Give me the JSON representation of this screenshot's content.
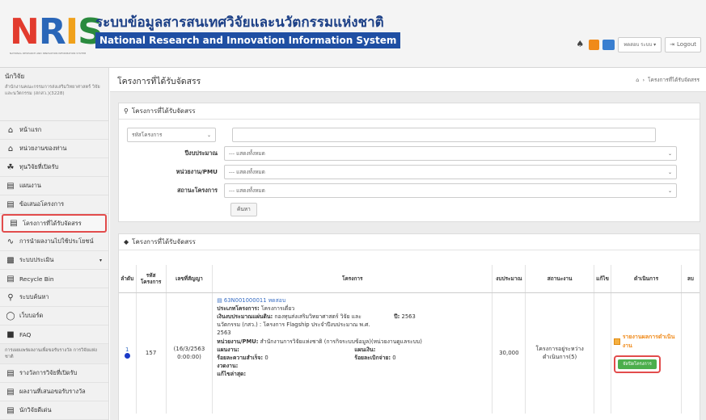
{
  "header": {
    "logo_text": "NRIS",
    "logo_subtitle": "NATIONAL RESEARCH AND INNOVATION INFORMATION SYSTEM",
    "title_th": "ระบบข้อมูลสารสนเทศวิจัยและนวัตกรรมแห่งชาติ",
    "title_en": "National Research and Innovation Information System",
    "user_label": "ทดสอบ ระบบ ▾",
    "logout_label": "Logout"
  },
  "sidebar": {
    "user_name": "นักวิจัย",
    "user_org": "สำนักงานคณะกรรมการส่งเสริมวิทยาศาสตร์ วิจัยและนวัตกรรม (สกสว.)(3228)",
    "items": [
      {
        "label": "หน้าแรก",
        "icon": "home-icon"
      },
      {
        "label": "หน่วยงานของท่าน",
        "icon": "home-icon"
      },
      {
        "label": "ทุนวิจัยที่เปิดรับ",
        "icon": "funding-icon"
      },
      {
        "label": "แผนงาน",
        "icon": "file-icon"
      },
      {
        "label": "ข้อเสนอโครงการ",
        "icon": "file-icon"
      },
      {
        "label": "โครงการที่ได้รับจัดสรร",
        "icon": "file-icon",
        "active": true
      },
      {
        "label": "การนำผลงานไปใช้ประโยชน์",
        "icon": "chart-line-icon"
      },
      {
        "label": "ระบบประเมิน",
        "icon": "bar-chart-icon",
        "caret": true
      },
      {
        "label": "Recycle Bin",
        "icon": "file-icon"
      },
      {
        "label": "ระบบค้นหา",
        "icon": "search-icon"
      },
      {
        "label": "เว็บบอร์ด",
        "icon": "globe-icon"
      },
      {
        "label": "FAQ",
        "icon": "faq-icon"
      }
    ],
    "section_label": "การเผยแพร่ผลงานเพื่อขอรับรางวัล การวิจัยแห่งชาติ",
    "items2": [
      {
        "label": "รางวัลการวิจัยที่เปิดรับ",
        "icon": "list-icon"
      },
      {
        "label": "ผลงานที่เสนอขอรับรางวัล",
        "icon": "list-icon"
      },
      {
        "label": "นักวิจัยดีเด่น",
        "icon": "list-icon"
      }
    ]
  },
  "page": {
    "title": "โครงการที่ได้รับจัดสรร",
    "breadcrumb": "โครงการที่ได้รับจัดสรร"
  },
  "search": {
    "panel_title": "โครงการที่ได้รับจัดสรร",
    "code_select": "รหัสโครงการ",
    "code_value": "",
    "fields": [
      {
        "label": "ปีงบประมาณ",
        "value": "--- แสดงทั้งหมด"
      },
      {
        "label": "หน่วยงาน/PMU",
        "value": "--- แสดงทั้งหมด"
      },
      {
        "label": "สถานะโครงการ",
        "value": "--- แสดงทั้งหมด"
      }
    ],
    "button_label": "ค้นหา"
  },
  "list": {
    "panel_title": "โครงการที่ได้รับจัดสรร",
    "columns": [
      "ลำดับ",
      "รหัสโครงการ",
      "เลขที่สัญญา",
      "โครงการ",
      "งบประมาณ",
      "สถานะงาน",
      "แก้ไข",
      "ดำเนินการ",
      "ลบ"
    ],
    "rows": [
      {
        "index": "1",
        "code": "157",
        "contract": "(16/3/2563 0:00:00)",
        "project_code": "63N001000011 ทดสอบ",
        "type_label": "ประเภทโครงการ:",
        "type_value": "โครงการเดี่ยว",
        "fund_label": "เงินงบประมาณแผ่นดิน:",
        "fund_value": "กองทุนส่งเสริมวิทยาศาสตร์ วิจัย และนวัตกรรม (กสว.) : โครงการ Flagship ประจำปีงบประมาณ พ.ศ. 2563",
        "year_label": "ปี:",
        "year_value": "2563",
        "agency_label": "หน่วยงาน/PMU:",
        "agency_value": "สำนักงานการวิจัยแห่งชาติ (การกิจระบบข้อมูล)(หน่วยงานดูแลระบบ)",
        "plan_label": "แผนงาน:",
        "plan_value": "",
        "sub_label": "แผนเงิน:",
        "sub_value": "",
        "progress_label": "ร้อยละความสำเร็จ:",
        "progress_value": "0",
        "disburse_label": "ร้อยละเบิกจ่าย:",
        "disburse_value": "0",
        "task_label": "งวดงาน:",
        "task_value": "",
        "last_edit_label": "แก้ไขล่าสุด:",
        "last_edit_value": "",
        "budget": "30,000",
        "status": "โครงการอยู่ระหว่างดำเนินการ(5)",
        "action_report": "รายงานผลการดำเนินงาน",
        "action_button": "จัดปิดโครงการ"
      }
    ]
  },
  "colors": {
    "header_blue": "#1f4fa3",
    "highlight_red": "#e24c4c",
    "action_orange": "#f08a1a",
    "button_green": "#4cae4c"
  }
}
